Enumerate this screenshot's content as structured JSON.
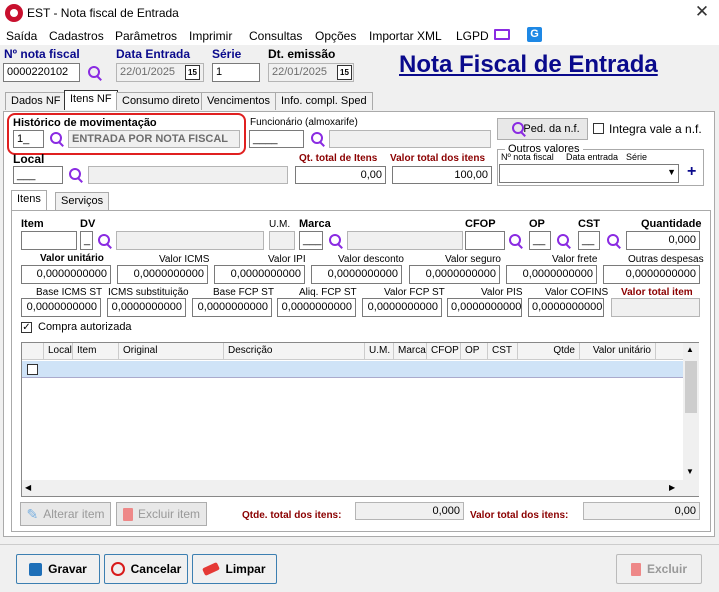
{
  "window": {
    "title": "EST - Nota fiscal de Entrada",
    "close": "✕"
  },
  "menu": [
    "Saída",
    "Cadastros",
    "Parâmetros",
    "Imprimir",
    "Consultas",
    "Opções",
    "Importar XML",
    "LGPD"
  ],
  "header": {
    "nota_label": "Nº nota fiscal",
    "nota_value": "0000220102",
    "data_entrada_label": "Data Entrada",
    "data_entrada_value": "22/01/2025",
    "serie_label": "Série",
    "serie_value": "1",
    "emissao_label": "Dt. emissão",
    "emissao_value": "22/01/2025",
    "big_title": "Nota Fiscal de Entrada",
    "cal_label": "15"
  },
  "tabs": [
    "Dados NF",
    "Itens NF",
    "Consumo direto",
    "Vencimentos",
    "Info. compl. Sped"
  ],
  "itens_nf": {
    "historico_label": "Histórico de movimentação",
    "historico_code": "1_",
    "historico_desc": "ENTRADA POR NOTA FISCAL",
    "funcionario_label": "Funcionário (almoxarife)",
    "funcionario_value": "____",
    "ped_label": "Ped. da n.f.",
    "integra_label": "Integra vale a n.f.",
    "local_label": "Local",
    "local_value": "___",
    "qt_total_label": "Qt. total de Itens",
    "qt_total_value": "0,00",
    "valor_total_label": "Valor total dos itens",
    "valor_total_value": "100,00",
    "outros_label": "Outros valores",
    "outros_cols": [
      "Nº nota fiscal",
      "Data entrada",
      "Série"
    ],
    "plus": "+"
  },
  "subtabs": [
    "Itens",
    "Serviços"
  ],
  "item_form": {
    "item": "Item",
    "dv": "DV",
    "dv_value": "_",
    "um": "U.M.",
    "marca": "Marca",
    "marca_value": "___",
    "cfop": "CFOP",
    "op": "OP",
    "op_value": "__",
    "cst": "CST",
    "cst_value": "__",
    "quantidade": "Quantidade",
    "quantidade_value": "0,000",
    "row2": [
      {
        "l": "Valor unitário",
        "v": "0,0000000000"
      },
      {
        "l": "Valor ICMS",
        "v": "0,0000000000"
      },
      {
        "l": "Valor IPI",
        "v": "0,0000000000"
      },
      {
        "l": "Valor desconto",
        "v": "0,0000000000"
      },
      {
        "l": "Valor seguro",
        "v": "0,0000000000"
      },
      {
        "l": "Valor frete",
        "v": "0,0000000000"
      },
      {
        "l": "Outras despesas",
        "v": "0,0000000000"
      }
    ],
    "row3": [
      {
        "l": "Base ICMS ST",
        "v": "0,0000000000"
      },
      {
        "l": "ICMS substituição",
        "v": "0,0000000000"
      },
      {
        "l": "Base FCP ST",
        "v": "0,0000000000"
      },
      {
        "l": "Aliq. FCP ST",
        "v": "0,0000000000"
      },
      {
        "l": "Valor FCP ST",
        "v": "0,0000000000"
      },
      {
        "l": "Valor PIS",
        "v": "0,0000000000"
      },
      {
        "l": "Valor COFINS",
        "v": "0,0000000000"
      },
      {
        "l": "Valor total item",
        "v": ""
      }
    ],
    "compra_label": "Compra autorizada"
  },
  "grid_cols": [
    "Local",
    "Item",
    "Original",
    "Descrição",
    "U.M.",
    "Marca",
    "CFOP",
    "OP",
    "CST",
    "Qtde",
    "Valor unitário"
  ],
  "item_actions": {
    "alterar": "Alterar item",
    "excluir": "Excluir item",
    "qtde_label": "Qtde. total dos itens:",
    "qtde_value": "0,000",
    "valor_label": "Valor total dos itens:",
    "valor_value": "0,00"
  },
  "footer": {
    "gravar": "Gravar",
    "cancelar": "Cancelar",
    "limpar": "Limpar",
    "excluir": "Excluir"
  },
  "colors": {
    "accent": "#0a0a8c",
    "highlight": "#e02020",
    "selection": "#cfe3f7"
  }
}
